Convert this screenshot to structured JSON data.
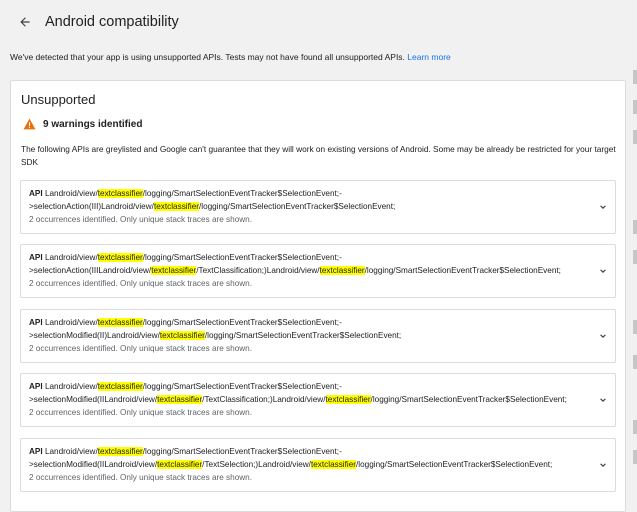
{
  "header": {
    "title": "Android compatibility"
  },
  "notice": {
    "text": "We've detected that your app is using unsupported APIs. Tests may not have found all unsupported APIs.",
    "link": "Learn more"
  },
  "card": {
    "title": "Unsupported",
    "warning": "9 warnings identified",
    "description": "The following APIs are greylisted and Google can't guarantee that they will work on existing versions of Android. Some may be already be restricted for your target SDK"
  },
  "items": [
    {
      "api_label": "API",
      "line1": [
        "Landroid/view/",
        "textclassifier",
        "/logging/SmartSelectionEventTracker$SelectionEvent;-"
      ],
      "line2": [
        ">selectionAction(III)Landroid/view/",
        "textclassifier",
        "/logging/SmartSelectionEventTracker$SelectionEvent;"
      ],
      "occurrences": "2 occurrences identified. Only unique stack traces are shown."
    },
    {
      "api_label": "API",
      "line1": [
        "Landroid/view/",
        "textclassifier",
        "/logging/SmartSelectionEventTracker$SelectionEvent;-"
      ],
      "line2": [
        ">selectionAction(IIILandroid/view/",
        "textclassifier",
        "/TextClassification;)Landroid/view/",
        "textclassifier",
        "/logging/SmartSelectionEventTracker$SelectionEvent;"
      ],
      "occurrences": "2 occurrences identified. Only unique stack traces are shown."
    },
    {
      "api_label": "API",
      "line1": [
        "Landroid/view/",
        "textclassifier",
        "/logging/SmartSelectionEventTracker$SelectionEvent;-"
      ],
      "line2": [
        ">selectionModified(II)Landroid/view/",
        "textclassifier",
        "/logging/SmartSelectionEventTracker$SelectionEvent;"
      ],
      "occurrences": "2 occurrences identified. Only unique stack traces are shown."
    },
    {
      "api_label": "API",
      "line1": [
        "Landroid/view/",
        "textclassifier",
        "/logging/SmartSelectionEventTracker$SelectionEvent;-"
      ],
      "line2": [
        ">selectionModified(IILandroid/view/",
        "textclassifier",
        "/TextClassification;)Landroid/view/",
        "textclassifier",
        "/logging/SmartSelectionEventTracker$SelectionEvent;"
      ],
      "occurrences": "2 occurrences identified. Only unique stack traces are shown."
    },
    {
      "api_label": "API",
      "line1": [
        "Landroid/view/",
        "textclassifier",
        "/logging/SmartSelectionEventTracker$SelectionEvent;-"
      ],
      "line2": [
        ">selectionModified(IILandroid/view/",
        "textclassifier",
        "/TextSelection;)Landroid/view/",
        "textclassifier",
        "/logging/SmartSelectionEventTracker$SelectionEvent;"
      ],
      "occurrences": "2 occurrences identified. Only unique stack traces are shown."
    }
  ],
  "colors": {
    "highlight": "#ffff00",
    "warning": "#e8710a",
    "link": "#1a73e8"
  },
  "icons": {
    "back": "arrow-left",
    "warning": "warning-triangle",
    "expand": "chevron-down"
  }
}
